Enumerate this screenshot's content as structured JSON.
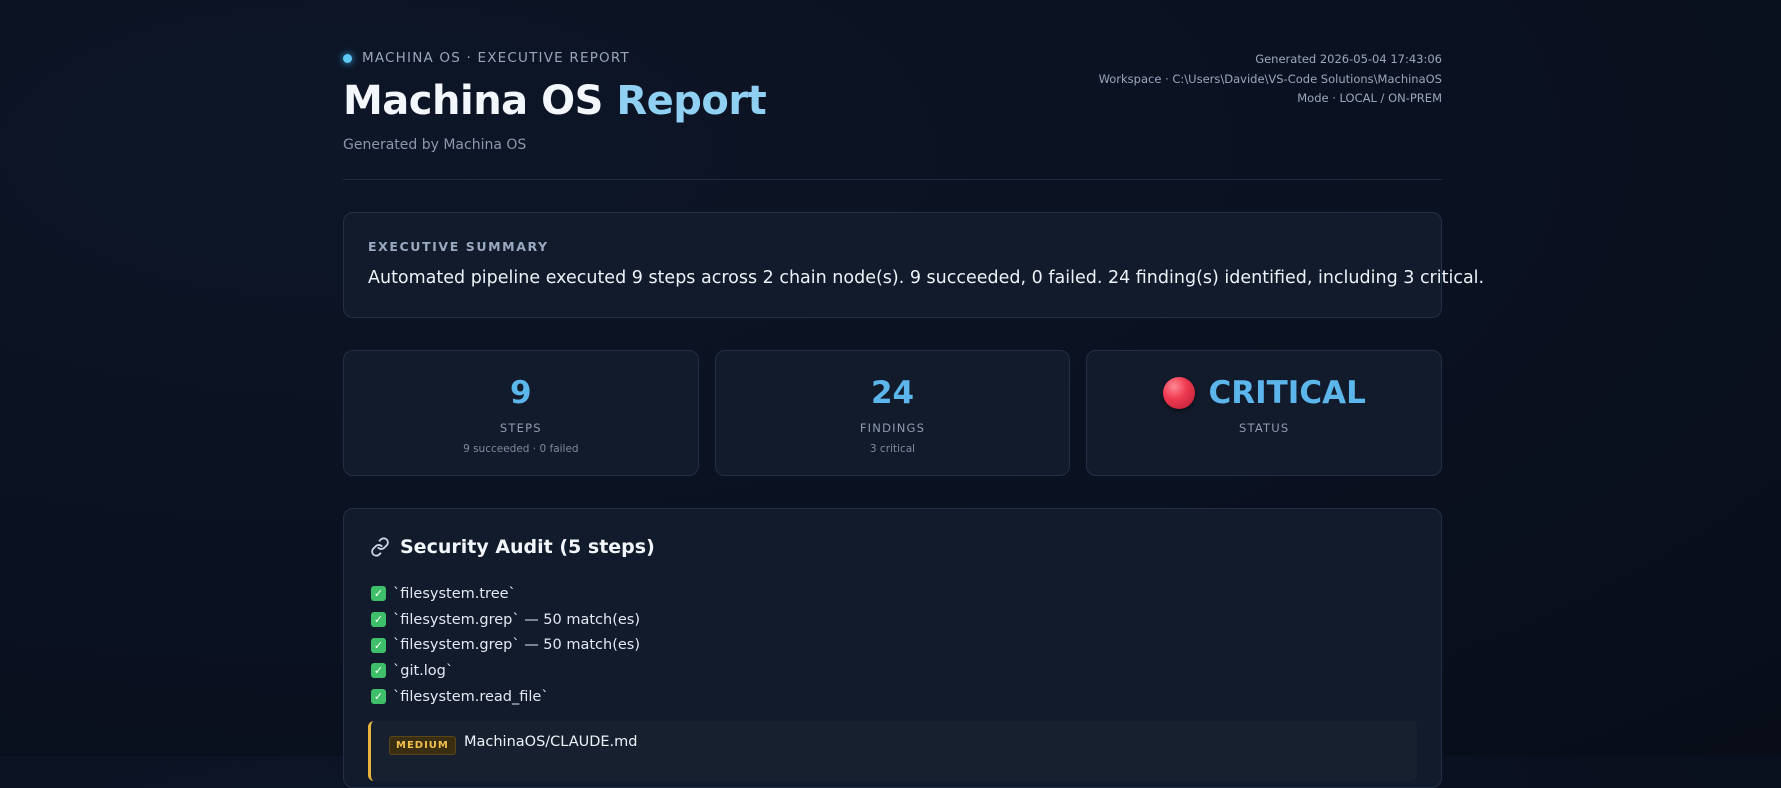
{
  "header": {
    "eyebrow": "MACHINA OS · EXECUTIVE REPORT",
    "title_main": "Machina OS ",
    "title_accent": "Report",
    "subtitle": "Generated by Machina OS",
    "meta": {
      "generated": "Generated 2026-05-04 17:43:06",
      "workspace": "Workspace · C:\\Users\\Davide\\VS-Code Solutions\\MachinaOS",
      "mode": "Mode · LOCAL / ON-PREM"
    }
  },
  "summary": {
    "label": "EXECUTIVE SUMMARY",
    "text": "Automated pipeline executed 9 steps across 2 chain node(s). 9 succeeded, 0 failed. 24 finding(s) identified, including 3 critical."
  },
  "stats": [
    {
      "value": "9",
      "name": "STEPS",
      "sub": "9 succeeded · 0 failed"
    },
    {
      "value": "24",
      "name": "FINDINGS",
      "sub": "3 critical"
    },
    {
      "value": "CRITICAL",
      "name": "STATUS",
      "indicator_color": "#ef3b52"
    }
  ],
  "audit": {
    "icon": "link-icon",
    "title": "Security Audit (5 steps)",
    "steps": [
      "`filesystem.tree`",
      "`filesystem.grep` — 50 match(es)",
      "`filesystem.grep` — 50 match(es)",
      "`git.log`",
      "`filesystem.read_file`"
    ],
    "finding": {
      "severity": "MEDIUM",
      "file": "MachinaOS/CLAUDE.md"
    }
  },
  "colors": {
    "accent": "#5cb6ec",
    "success": "#3fbf6a",
    "critical": "#ef3b52",
    "medium": "#e8b33c"
  }
}
